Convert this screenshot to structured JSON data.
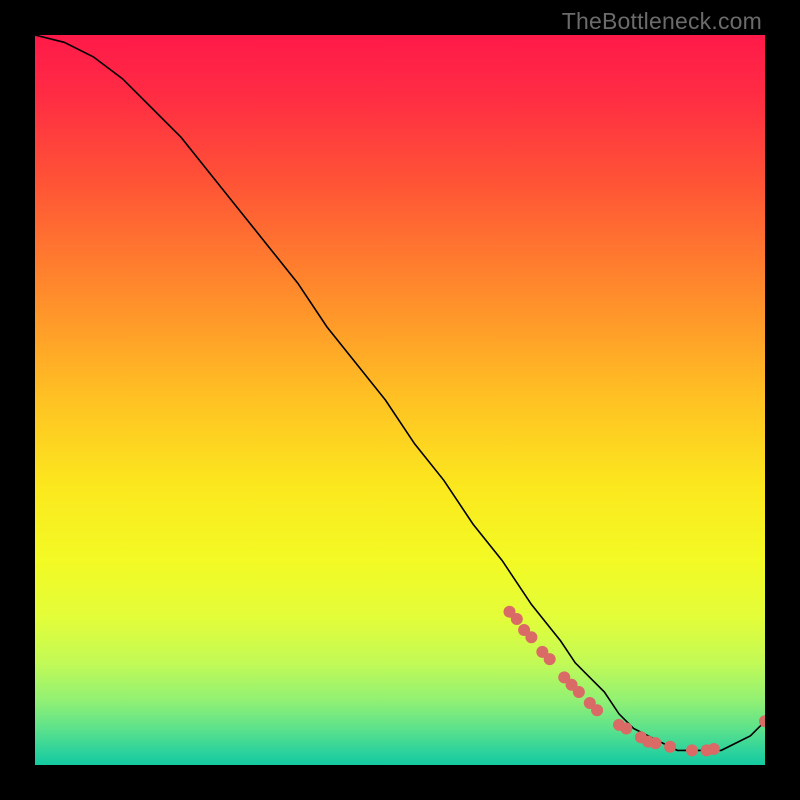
{
  "watermark": "TheBottleneck.com",
  "chart_data": {
    "type": "line",
    "title": "",
    "xlabel": "",
    "ylabel": "",
    "xlim": [
      0,
      100
    ],
    "ylim": [
      0,
      100
    ],
    "grid": false,
    "legend": false,
    "background": "gradient red-yellow-green",
    "series": [
      {
        "name": "curve",
        "x": [
          0,
          4,
          8,
          12,
          16,
          20,
          24,
          28,
          32,
          36,
          40,
          44,
          48,
          52,
          56,
          60,
          64,
          68,
          72,
          74,
          76,
          78,
          80,
          82,
          84,
          86,
          88,
          90,
          92,
          94,
          96,
          98,
          100
        ],
        "values": [
          100,
          99,
          97,
          94,
          90,
          86,
          81,
          76,
          71,
          66,
          60,
          55,
          50,
          44,
          39,
          33,
          28,
          22,
          17,
          14,
          12,
          10,
          7,
          5,
          4,
          3,
          2,
          2,
          2,
          2,
          3,
          4,
          6
        ]
      }
    ],
    "markers": [
      {
        "x": 65,
        "y": 21
      },
      {
        "x": 66,
        "y": 20
      },
      {
        "x": 67,
        "y": 18.5
      },
      {
        "x": 68,
        "y": 17.5
      },
      {
        "x": 69.5,
        "y": 15.5
      },
      {
        "x": 70.5,
        "y": 14.5
      },
      {
        "x": 72.5,
        "y": 12
      },
      {
        "x": 73.5,
        "y": 11
      },
      {
        "x": 74.5,
        "y": 10
      },
      {
        "x": 76,
        "y": 8.5
      },
      {
        "x": 77,
        "y": 7.5
      },
      {
        "x": 80,
        "y": 5.5
      },
      {
        "x": 81,
        "y": 5
      },
      {
        "x": 83,
        "y": 3.8
      },
      {
        "x": 84,
        "y": 3.2
      },
      {
        "x": 85,
        "y": 3
      },
      {
        "x": 87,
        "y": 2.5
      },
      {
        "x": 90,
        "y": 2
      },
      {
        "x": 92,
        "y": 2
      },
      {
        "x": 93,
        "y": 2.2
      },
      {
        "x": 100,
        "y": 6
      }
    ],
    "colors": {
      "line": "#000000",
      "marker": "#d96a66",
      "gradient_stops": [
        {
          "offset": 0.0,
          "color": "#ff1a49"
        },
        {
          "offset": 0.08,
          "color": "#ff2b44"
        },
        {
          "offset": 0.2,
          "color": "#ff5336"
        },
        {
          "offset": 0.35,
          "color": "#ff8a2c"
        },
        {
          "offset": 0.5,
          "color": "#ffc223"
        },
        {
          "offset": 0.62,
          "color": "#fbe81e"
        },
        {
          "offset": 0.72,
          "color": "#f3fa24"
        },
        {
          "offset": 0.8,
          "color": "#e2fd3a"
        },
        {
          "offset": 0.86,
          "color": "#c2fa56"
        },
        {
          "offset": 0.91,
          "color": "#93f173"
        },
        {
          "offset": 0.95,
          "color": "#5de28b"
        },
        {
          "offset": 0.98,
          "color": "#2fd39b"
        },
        {
          "offset": 1.0,
          "color": "#14caa1"
        }
      ]
    }
  }
}
